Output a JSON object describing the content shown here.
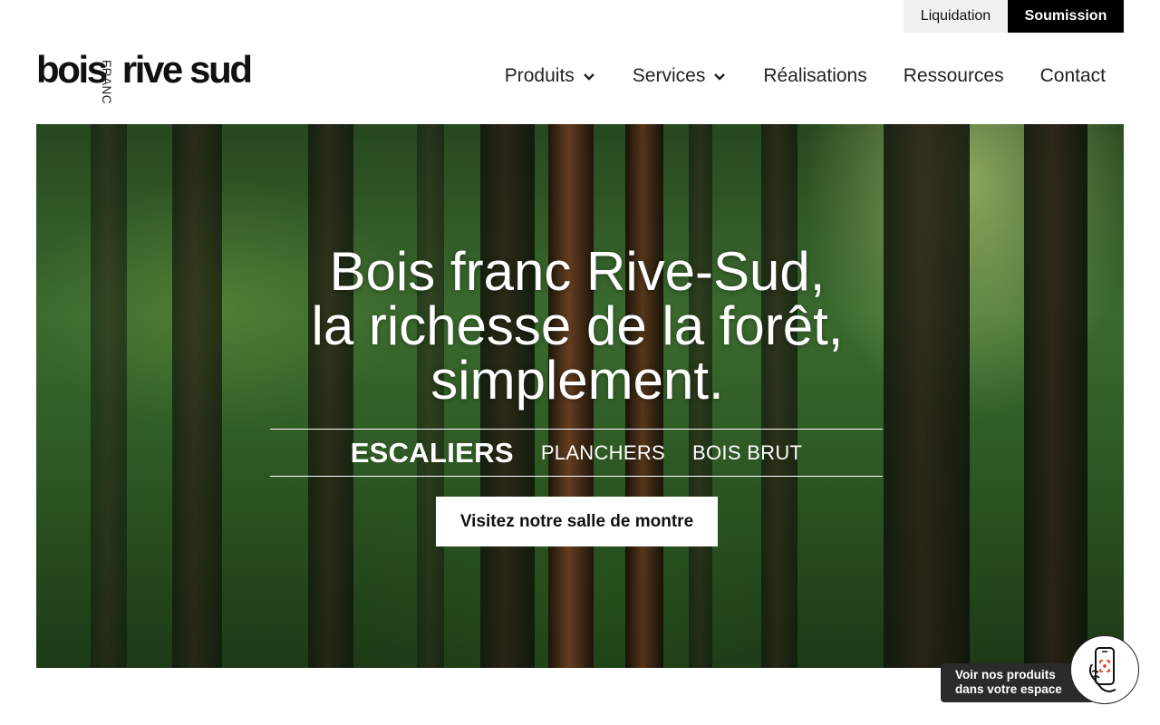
{
  "topbar": {
    "liquidation": "Liquidation",
    "soumission": "Soumission"
  },
  "logo": {
    "word1": "bois",
    "word_franc": "FRANC",
    "word2": "rive sud"
  },
  "nav": {
    "items": [
      {
        "label": "Produits",
        "has_dropdown": true
      },
      {
        "label": "Services",
        "has_dropdown": true
      },
      {
        "label": "Réalisations",
        "has_dropdown": false
      },
      {
        "label": "Ressources",
        "has_dropdown": false
      },
      {
        "label": "Contact",
        "has_dropdown": false
      }
    ]
  },
  "hero": {
    "title_lines": [
      "Bois franc Rive-Sud,",
      "la richesse de la forêt,",
      "simplement."
    ],
    "categories": [
      "ESCALIERS",
      "PLANCHERS",
      "BOIS BRUT"
    ],
    "active_category": "ESCALIERS",
    "cta": "Visitez notre salle de montre"
  },
  "widget": {
    "label_line1": "Voir nos produits",
    "label_line2": "dans votre espace",
    "icon": "phone-ar-icon"
  },
  "colors": {
    "accent": "#000000",
    "topbar_light": "#f1f1f1",
    "widget_dark": "#2b2b2b",
    "ar_marker": "#e0431f"
  }
}
